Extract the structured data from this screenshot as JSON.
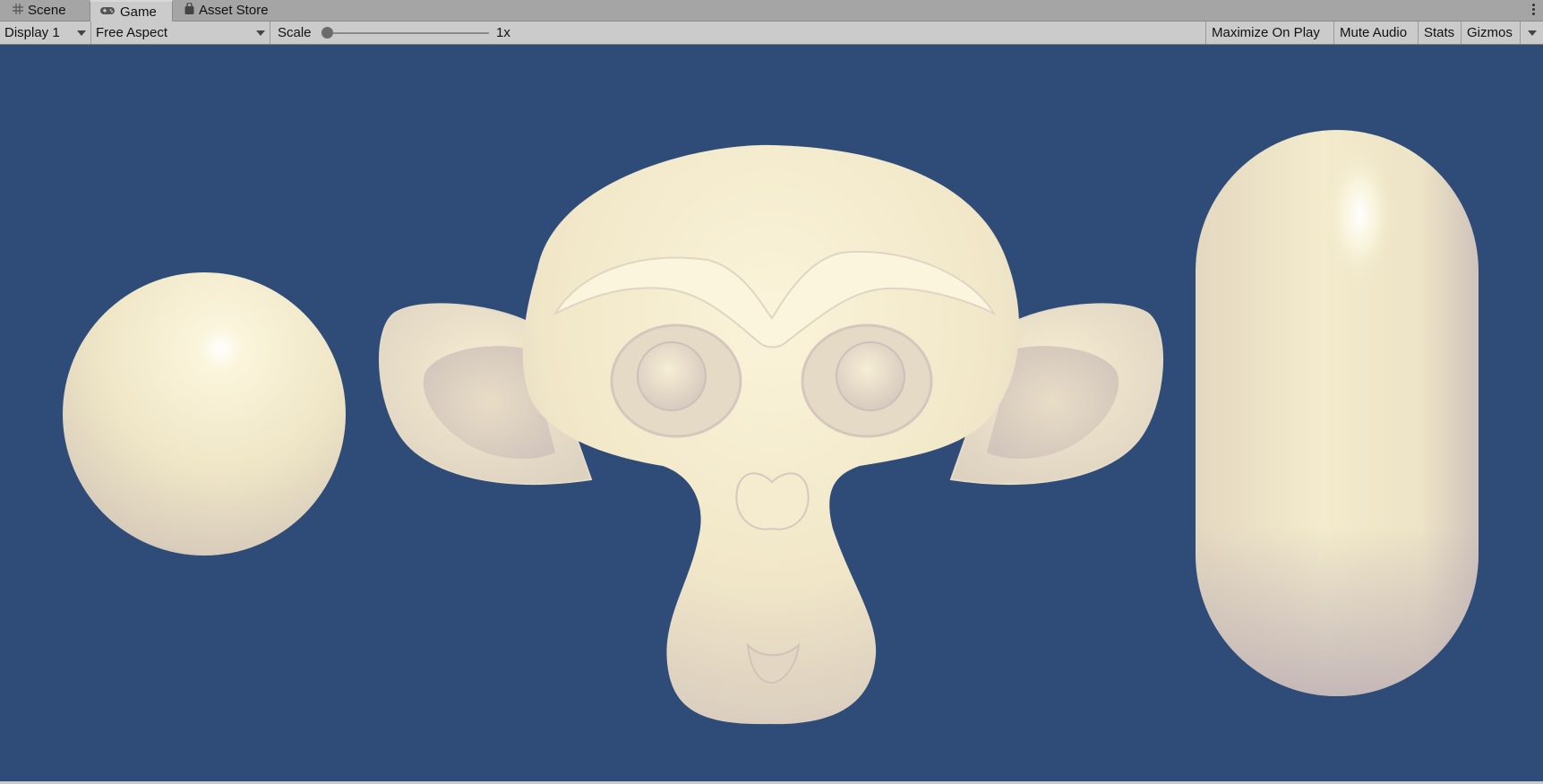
{
  "tabs": [
    {
      "label": "Scene",
      "icon": "grid-icon",
      "active": false
    },
    {
      "label": "Game",
      "icon": "gamepad-icon",
      "active": true
    },
    {
      "label": "Asset Store",
      "icon": "shopping-bag-icon",
      "active": false
    }
  ],
  "toolbar": {
    "display": "Display 1",
    "aspect": "Free Aspect",
    "scale_label": "Scale",
    "scale_value": "1x",
    "scale_level": 0.0,
    "maximize_on_play": "Maximize On Play",
    "mute_audio": "Mute Audio",
    "stats": "Stats",
    "gizmos": "Gizmos"
  },
  "scene": {
    "background_color": "#2f4c78",
    "object_color": "#f3ebcc",
    "objects": [
      "sphere",
      "monkey-head",
      "capsule"
    ]
  }
}
